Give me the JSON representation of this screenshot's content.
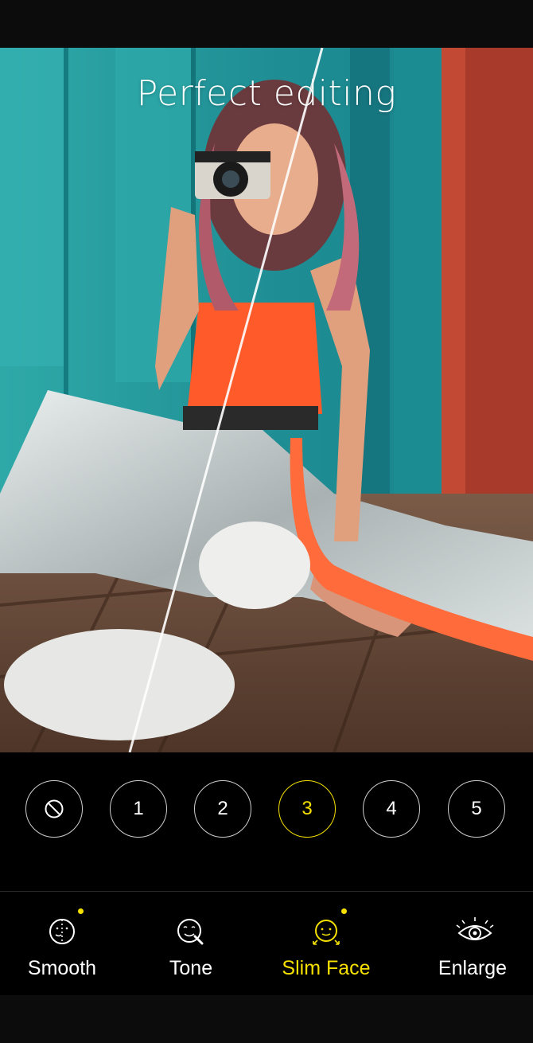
{
  "headline": "Perfect editing",
  "levels": {
    "items": [
      "1",
      "2",
      "3",
      "4",
      "5"
    ],
    "selected": "3"
  },
  "tools": [
    {
      "label": "Smooth",
      "icon": "smooth-icon",
      "has_dot": true
    },
    {
      "label": "Tone",
      "icon": "tone-icon",
      "has_dot": false
    },
    {
      "label": "Slim Face",
      "icon": "slim-face-icon",
      "has_dot": true
    },
    {
      "label": "Enlarge",
      "icon": "enlarge-eye-icon",
      "has_dot": false
    }
  ],
  "active_tool": "Slim Face",
  "colors": {
    "accent": "#f5e000",
    "background": "#000000",
    "wall": "#2aa3a4",
    "top": "#ff5a2a"
  }
}
